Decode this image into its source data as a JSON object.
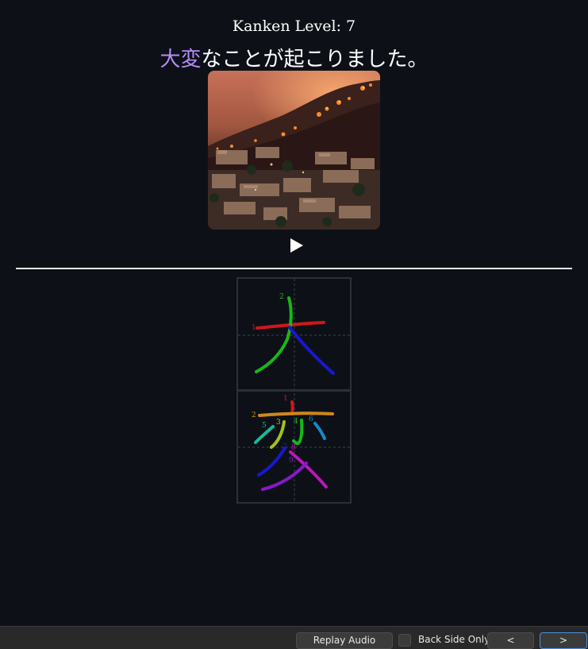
{
  "card": {
    "level_text": "Kanken Level: 7",
    "sentence": {
      "highlight": "大変",
      "rest": "なことが起こりました。",
      "highlight_color": "#b48cf5"
    },
    "image_description_icon": "wildfire-photo",
    "play_icon": "play-icon"
  },
  "stroke_order": {
    "kanji": [
      "大",
      "変"
    ],
    "kanji_1_numbers": [
      "1",
      "2"
    ],
    "kanji_2_numbers": [
      "1",
      "2",
      "3",
      "4",
      "5",
      "6",
      "7",
      "8",
      "9"
    ]
  },
  "toolbar": {
    "replay_label": "Replay Audio",
    "back_side_label": "Back Side Only",
    "back_side_checked": false,
    "prev_label": "<",
    "next_label": ">"
  }
}
